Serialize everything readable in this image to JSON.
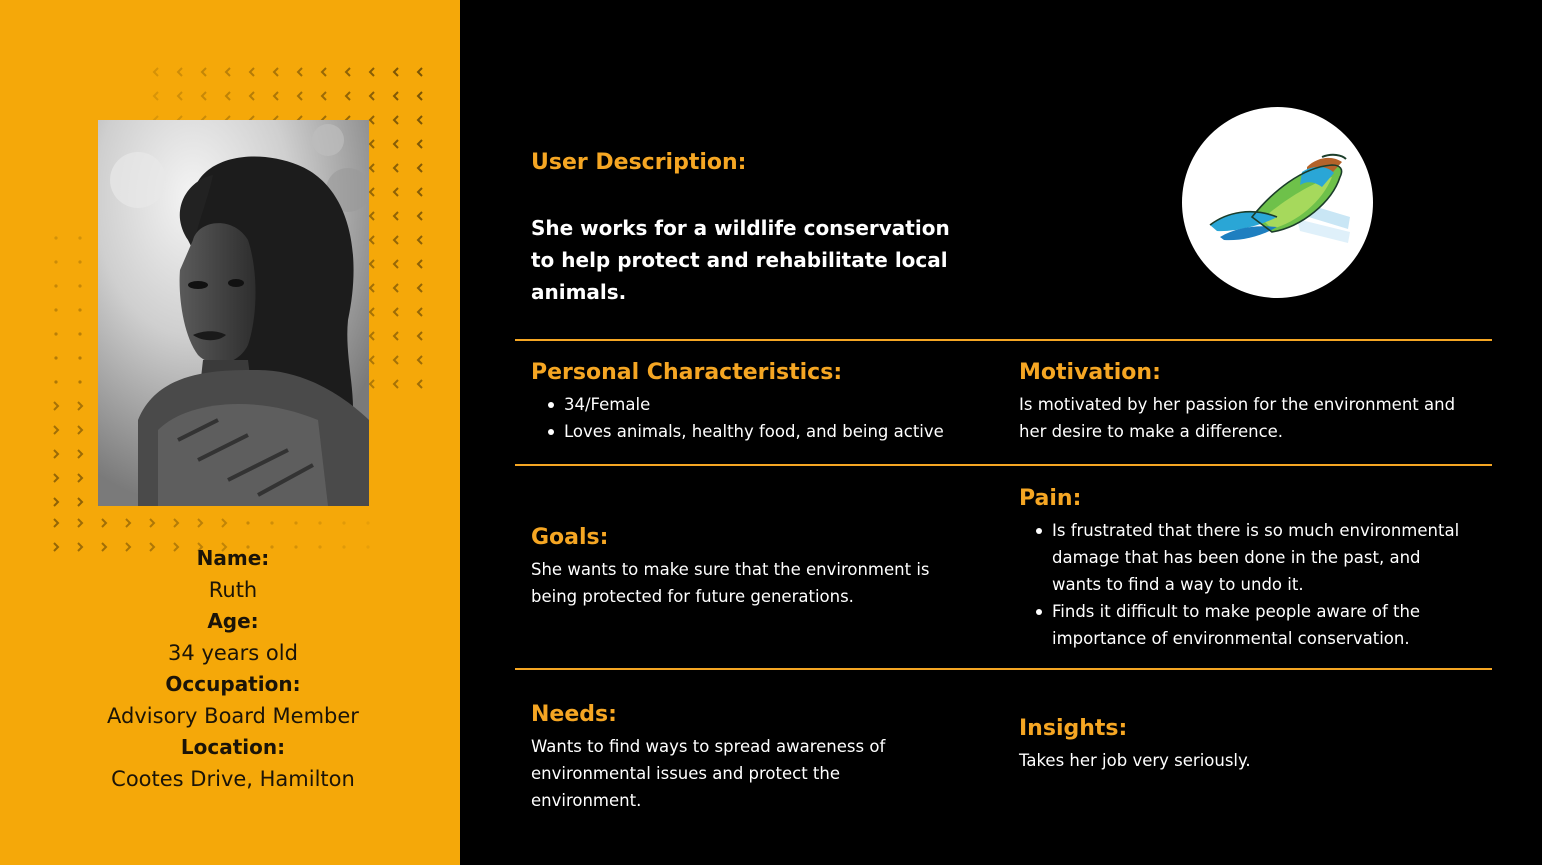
{
  "profile": {
    "name_label": "Name:",
    "name": "Ruth",
    "age_label": "Age:",
    "age": "34 years old",
    "occupation_label": "Occupation:",
    "occupation": "Advisory Board Member",
    "location_label": "Location:",
    "location": "Cootes Drive, Hamilton"
  },
  "user_description": {
    "title": "User Description:",
    "text": "She works for a wildlife conservation to help protect and rehabilitate local animals."
  },
  "personal_characteristics": {
    "title": "Personal Characteristics:",
    "items": [
      "34/Female",
      "Loves animals, healthy food, and being active"
    ]
  },
  "motivation": {
    "title": "Motivation:",
    "text": "Is motivated by her passion for the environment and her desire to make a difference."
  },
  "goals": {
    "title": "Goals:",
    "text": "She wants to make sure that the environment is being protected for future generations."
  },
  "pain": {
    "title": "Pain:",
    "items": [
      "Is frustrated that there is so much environmental damage that has been done in the past, and wants to find a way to undo it.",
      "Finds it difficult to make people aware of the importance of environmental conservation."
    ]
  },
  "needs": {
    "title": "Needs:",
    "text": "Wants to find ways to spread awareness of environmental issues and protect the environment."
  },
  "insights": {
    "title": "Insights:",
    "text": "Takes her job very seriously."
  },
  "colors": {
    "panel": "#f5a809",
    "accent": "#f5a623",
    "background": "#000000",
    "text": "#ffffff"
  },
  "icons": {
    "logo": "bird-logo-icon",
    "photo": "persona-photo"
  }
}
